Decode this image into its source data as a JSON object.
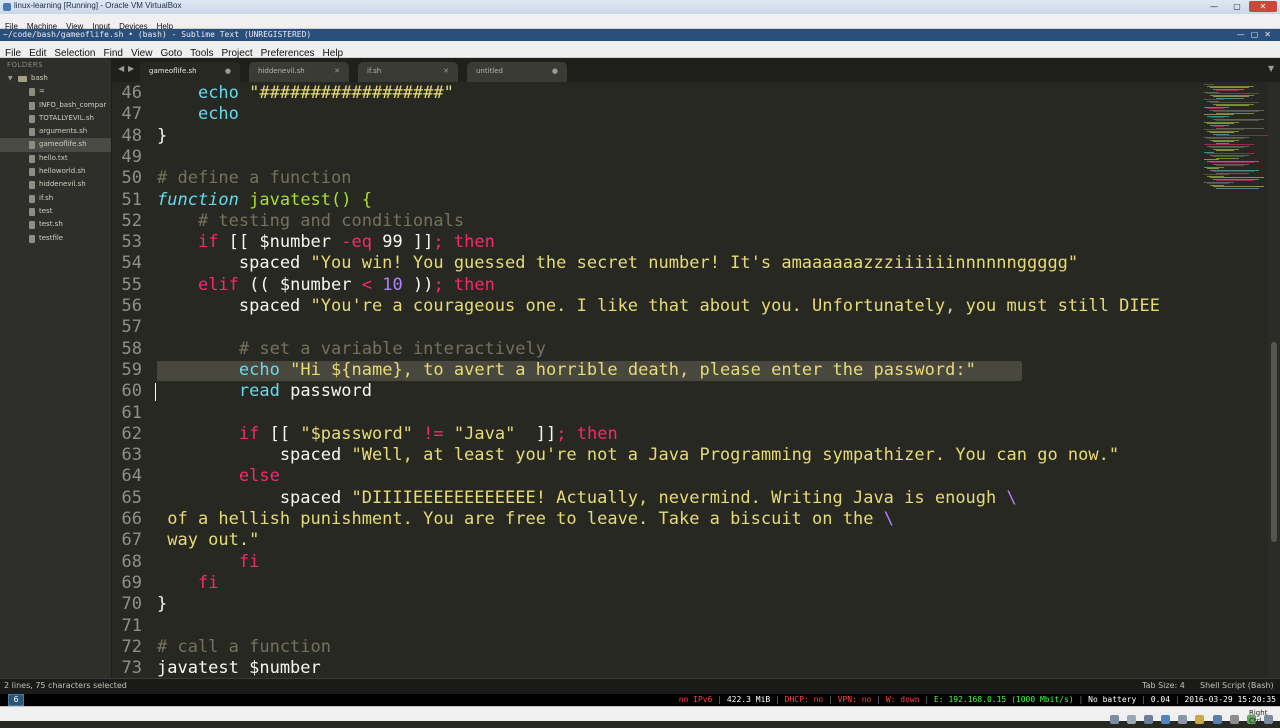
{
  "vbox": {
    "title": "linux-learning [Running] - Oracle VM VirtualBox",
    "menu": [
      "File",
      "Machine",
      "View",
      "Input",
      "Devices",
      "Help"
    ],
    "host_key": "Right Ctrl"
  },
  "sublime": {
    "title": "~/code/bash/gameoflife.sh • (bash) - Sublime Text (UNREGISTERED)",
    "menu": [
      "File",
      "Edit",
      "Selection",
      "Find",
      "View",
      "Goto",
      "Tools",
      "Project",
      "Preferences",
      "Help"
    ]
  },
  "sidebar": {
    "header": "FOLDERS",
    "folder": "bash",
    "items": [
      {
        "label": "="
      },
      {
        "label": "INFO_bash_compar"
      },
      {
        "label": "TOTALLYEVIL.sh"
      },
      {
        "label": "arguments.sh"
      },
      {
        "label": "gameoflife.sh",
        "selected": true
      },
      {
        "label": "hello.txt"
      },
      {
        "label": "helloworld.sh"
      },
      {
        "label": "hiddenevil.sh"
      },
      {
        "label": "if.sh"
      },
      {
        "label": "test"
      },
      {
        "label": "test.sh"
      },
      {
        "label": "testfile"
      }
    ]
  },
  "tabs": [
    {
      "label": "gameoflife.sh",
      "active": true,
      "dirty": true
    },
    {
      "label": "hiddenevil.sh",
      "active": false,
      "dirty": false
    },
    {
      "label": "if.sh",
      "active": false,
      "dirty": false
    },
    {
      "label": "untitled",
      "active": false,
      "dirty": true
    }
  ],
  "status": {
    "left": "2 lines, 75 characters selected",
    "tab_size": "Tab Size: 4",
    "syntax": "Shell Script (Bash)"
  },
  "i3bar": {
    "workspace": "6",
    "segments": [
      {
        "text": "no IPv6",
        "color": "red"
      },
      {
        "text": "422.3 MiB",
        "color": "white"
      },
      {
        "text": "DHCP: no",
        "color": "red"
      },
      {
        "text": "VPN: no",
        "color": "red"
      },
      {
        "text": "W: down",
        "color": "red"
      },
      {
        "text": "E: 192.168.0.15 (1000 Mbit/s)",
        "color": "green"
      },
      {
        "text": "No battery",
        "color": "white"
      },
      {
        "text": "0.04",
        "color": "white"
      },
      {
        "text": "2016-03-29 15:20:35",
        "color": "white"
      }
    ]
  },
  "editor": {
    "lines": [
      {
        "n": "46",
        "tokens": [
          [
            "    ",
            "k-var"
          ],
          [
            "echo",
            "k-bi"
          ],
          [
            " ",
            "k-var"
          ],
          [
            "\"##################\"",
            "k-str"
          ]
        ]
      },
      {
        "n": "47",
        "tokens": [
          [
            "    ",
            "k-var"
          ],
          [
            "echo",
            "k-bi"
          ]
        ]
      },
      {
        "n": "48",
        "tokens": [
          [
            "}",
            "k-var"
          ]
        ]
      },
      {
        "n": "49",
        "tokens": []
      },
      {
        "n": "50",
        "tokens": [
          [
            "# define a function",
            "k-cmt"
          ]
        ]
      },
      {
        "n": "51",
        "tokens": [
          [
            "function",
            "k-func"
          ],
          [
            " ",
            "k-var"
          ],
          [
            "javatest",
            "k-fn"
          ],
          [
            "() {",
            "k-fn"
          ]
        ]
      },
      {
        "n": "52",
        "tokens": [
          [
            "    ",
            "k-var"
          ],
          [
            "# testing and conditionals",
            "k-cmt"
          ]
        ]
      },
      {
        "n": "53",
        "tokens": [
          [
            "    ",
            "k-var"
          ],
          [
            "if",
            "k-kw"
          ],
          [
            " [[ $number ",
            "k-var"
          ],
          [
            "-eq",
            "k-op"
          ],
          [
            " 99 ]]",
            "k-var"
          ],
          [
            "; then",
            "k-kw"
          ]
        ]
      },
      {
        "n": "54",
        "tokens": [
          [
            "        spaced ",
            "k-var"
          ],
          [
            "\"You win! You guessed the secret number! It's amaaaaaazzziiiiiinnnnnnggggg\"",
            "k-str"
          ]
        ]
      },
      {
        "n": "55",
        "tokens": [
          [
            "    ",
            "k-var"
          ],
          [
            "elif",
            "k-kw"
          ],
          [
            " (( $number ",
            "k-var"
          ],
          [
            "<",
            "k-op"
          ],
          [
            " ",
            "k-var"
          ],
          [
            "10",
            "k-num"
          ],
          [
            " ))",
            "k-var"
          ],
          [
            "; then",
            "k-kw"
          ]
        ]
      },
      {
        "n": "56",
        "tokens": [
          [
            "        spaced ",
            "k-var"
          ],
          [
            "\"You're a courageous one. I like that about you. Unfortunately, you must still DIEE",
            "k-str"
          ]
        ]
      },
      {
        "n": "57",
        "tokens": []
      },
      {
        "n": "58",
        "tokens": [
          [
            "        ",
            "k-var"
          ],
          [
            "# set a variable interactively",
            "k-cmt"
          ]
        ]
      },
      {
        "n": "59",
        "selected": true,
        "tokens": [
          [
            "        ",
            "k-var"
          ],
          [
            "echo",
            "k-bi"
          ],
          [
            " ",
            "k-var"
          ],
          [
            "\"Hi ${name}, to avert a horrible death, please enter the password:\"",
            "k-str"
          ]
        ]
      },
      {
        "n": "60",
        "tokens": [
          [
            "        ",
            "k-var"
          ],
          [
            "read",
            "k-bi"
          ],
          [
            " password",
            "k-var"
          ]
        ]
      },
      {
        "n": "61",
        "tokens": []
      },
      {
        "n": "62",
        "tokens": [
          [
            "        ",
            "k-var"
          ],
          [
            "if",
            "k-kw"
          ],
          [
            " [[ ",
            "k-var"
          ],
          [
            "\"$password\"",
            "k-str"
          ],
          [
            " ",
            "k-var"
          ],
          [
            "!=",
            "k-op"
          ],
          [
            " ",
            "k-var"
          ],
          [
            "\"Java\"",
            "k-str"
          ],
          [
            "  ]]",
            "k-var"
          ],
          [
            "; then",
            "k-kw"
          ]
        ]
      },
      {
        "n": "63",
        "tokens": [
          [
            "            spaced ",
            "k-var"
          ],
          [
            "\"Well, at least you're not a Java Programming sympathizer. You can go now.\"",
            "k-str"
          ]
        ]
      },
      {
        "n": "64",
        "tokens": [
          [
            "        ",
            "k-var"
          ],
          [
            "else",
            "k-kw"
          ]
        ]
      },
      {
        "n": "65",
        "tokens": [
          [
            "            spaced ",
            "k-var"
          ],
          [
            "\"DIIIIEEEEEEEEEEEE! Actually, nevermind. Writing Java is enough ",
            "k-str"
          ],
          [
            "\\",
            "k-esc"
          ]
        ]
      },
      {
        "n": "66",
        "tokens": [
          [
            " of a hellish punishment. You are free to leave. Take a biscuit on the ",
            "k-str"
          ],
          [
            "\\",
            "k-esc"
          ]
        ]
      },
      {
        "n": "67",
        "tokens": [
          [
            " way out.\"",
            "k-str"
          ]
        ]
      },
      {
        "n": "68",
        "tokens": [
          [
            "        ",
            "k-var"
          ],
          [
            "fi",
            "k-kw"
          ]
        ]
      },
      {
        "n": "69",
        "tokens": [
          [
            "    ",
            "k-var"
          ],
          [
            "fi",
            "k-kw"
          ]
        ]
      },
      {
        "n": "70",
        "tokens": [
          [
            "}",
            "k-var"
          ]
        ]
      },
      {
        "n": "71",
        "tokens": []
      },
      {
        "n": "72",
        "tokens": [
          [
            "# call a function",
            "k-cmt"
          ]
        ]
      },
      {
        "n": "73",
        "tokens": [
          [
            "javatest $number",
            "k-var"
          ]
        ]
      }
    ]
  },
  "colors": {
    "editor_bg": "#272822",
    "selection": "#49483e",
    "keyword": "#f92672",
    "string": "#e6db74",
    "comment": "#75715e",
    "function": "#a6e22e",
    "builtin": "#66d9ef",
    "number": "#ae81ff"
  }
}
